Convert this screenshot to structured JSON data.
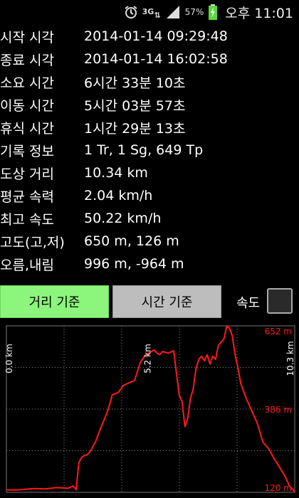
{
  "status_bar": {
    "network": "3G",
    "battery_percent": "57%",
    "time": "오후 11:01",
    "icons": [
      "alarm-icon",
      "network-3g-icon",
      "signal-icon",
      "battery-charging-icon"
    ]
  },
  "stats": [
    {
      "label": "시작 시각",
      "value": "2014-01-14 09:29:48"
    },
    {
      "label": "종료 시각",
      "value": "2014-01-14 16:02:58"
    },
    {
      "label": "소요 시간",
      "value": "6시간 33분 10초"
    },
    {
      "label": "이동 시간",
      "value": "5시간 03분 57초"
    },
    {
      "label": "휴식 시간",
      "value": "1시간 29분 13초"
    },
    {
      "label": "기록 정보",
      "value": "1 Tr, 1 Sg, 649 Tp"
    },
    {
      "label": "도상 거리",
      "value": "10.34 km"
    },
    {
      "label": "평균 속력",
      "value": "2.04 km/h"
    },
    {
      "label": "최고 속도",
      "value": "50.22 km/h"
    },
    {
      "label": "고도(고,저)",
      "value": "650 m, 126 m"
    },
    {
      "label": "오름,내림",
      "value": "996 m, -964 m"
    }
  ],
  "buttons": {
    "distance": "거리 기준",
    "time": "시간 기준",
    "speed_label": "속도",
    "speed_checked": false
  },
  "colors": {
    "active_button": "#8cf57c",
    "inactive_button": "#bdbdbd",
    "profile_line": "#ff1a1a"
  },
  "chart_data": {
    "type": "line",
    "title": "",
    "xlabel": "",
    "ylabel": "",
    "x_ticks": [
      "0.0 km",
      "5.2 km",
      "10.3 km"
    ],
    "y_ticks": [
      "652 m",
      "386 m",
      "120 m"
    ],
    "xlim": [
      0,
      10.34
    ],
    "ylim": [
      120,
      652
    ],
    "grid": true,
    "series": [
      {
        "values_x": [
          0.0,
          0.3,
          0.6,
          1.0,
          1.4,
          1.8,
          2.2,
          2.4,
          2.5,
          2.6,
          2.7,
          2.8,
          2.9,
          3.0,
          3.2,
          3.4,
          3.6,
          3.7,
          3.8,
          4.0,
          4.2,
          4.4,
          4.6,
          4.8,
          5.0,
          5.2,
          5.3,
          5.4,
          5.5,
          5.6,
          5.8,
          6.0,
          6.1,
          6.2,
          6.3,
          6.4,
          6.5,
          6.6,
          6.7,
          6.8,
          6.9,
          7.0,
          7.1,
          7.2,
          7.3,
          7.4,
          7.5,
          7.6,
          7.7,
          7.8,
          7.9,
          8.0,
          8.1,
          8.2,
          8.3,
          8.4,
          8.6,
          8.8,
          9.0,
          9.2,
          9.4,
          9.6,
          9.8,
          10.0,
          10.15,
          10.34
        ],
        "values_y": [
          128,
          127,
          129,
          132,
          131,
          135,
          133,
          140,
          128,
          215,
          232,
          238,
          240,
          250,
          282,
          330,
          372,
          400,
          432,
          438,
          462,
          470,
          478,
          535,
          560,
          570,
          575,
          565,
          560,
          570,
          565,
          572,
          500,
          430,
          410,
          330,
          355,
          420,
          450,
          515,
          545,
          555,
          540,
          560,
          530,
          555,
          545,
          590,
          600,
          610,
          650,
          645,
          620,
          560,
          520,
          470,
          420,
          380,
          340,
          280,
          260,
          228,
          200,
          170,
          140,
          122
        ]
      }
    ]
  }
}
